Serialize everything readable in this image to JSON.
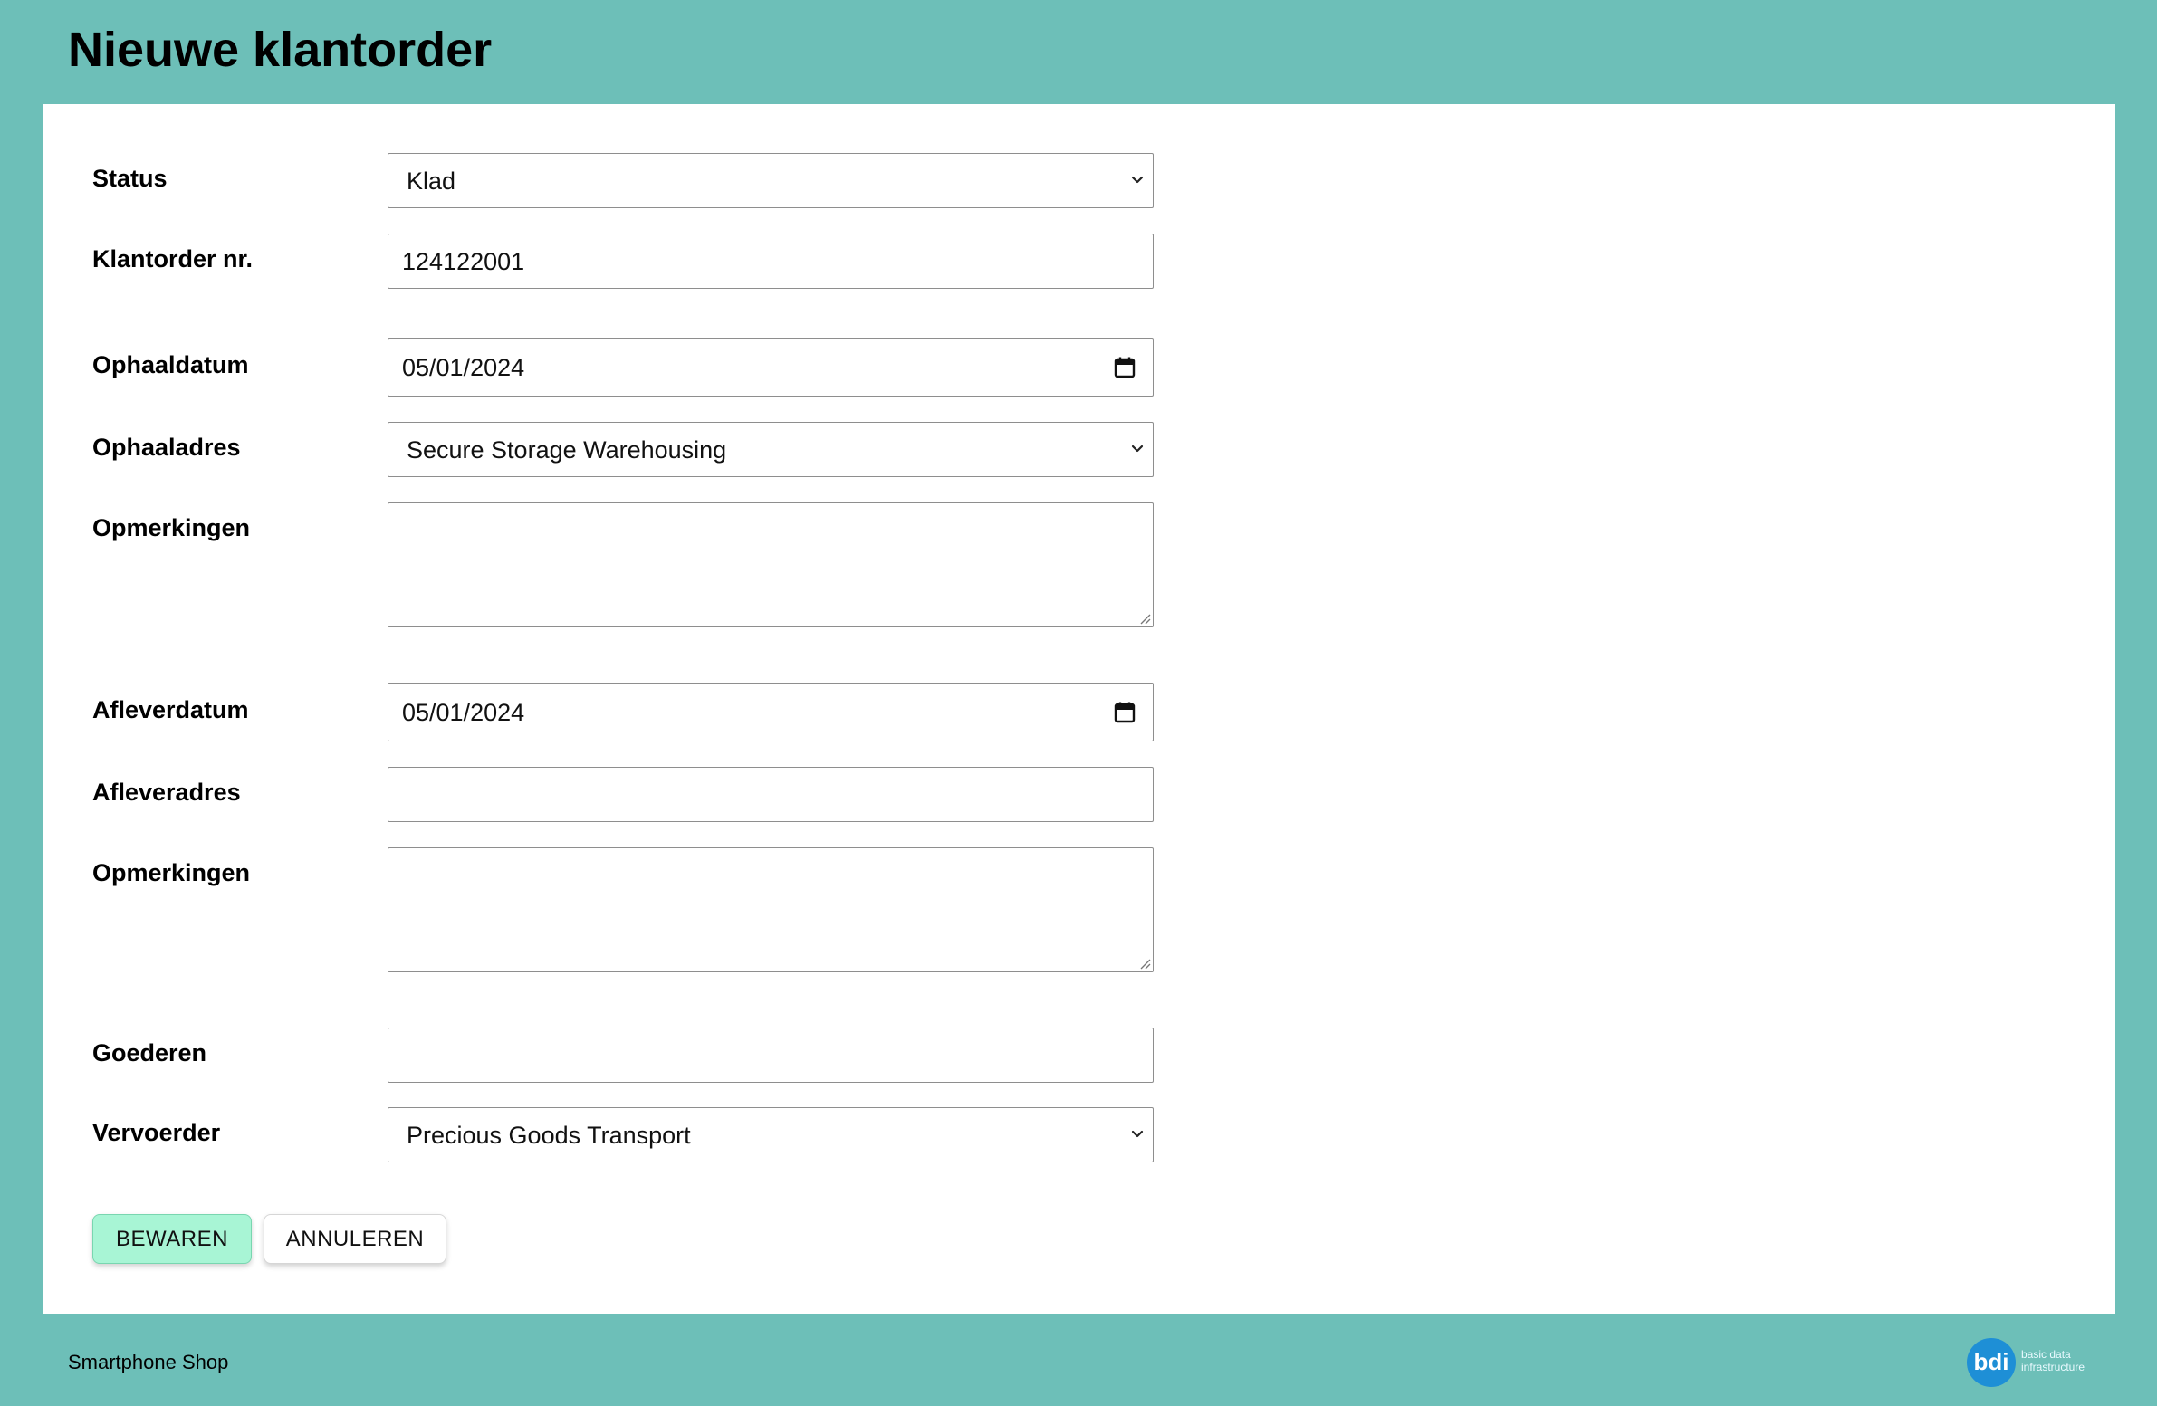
{
  "header": {
    "title": "Nieuwe klantorder"
  },
  "form": {
    "status": {
      "label": "Status",
      "value": "Klad"
    },
    "order_number": {
      "label": "Klantorder nr.",
      "value": "124122001"
    },
    "pickup_date": {
      "label": "Ophaaldatum",
      "value": "05/01/2024"
    },
    "pickup_address": {
      "label": "Ophaaladres",
      "value": "Secure Storage Warehousing"
    },
    "pickup_remarks": {
      "label": "Opmerkingen",
      "value": ""
    },
    "delivery_date": {
      "label": "Afleverdatum",
      "value": "05/01/2024"
    },
    "delivery_address": {
      "label": "Afleveradres",
      "value": ""
    },
    "delivery_remarks": {
      "label": "Opmerkingen",
      "value": ""
    },
    "goods": {
      "label": "Goederen",
      "value": ""
    },
    "carrier": {
      "label": "Vervoerder",
      "value": "Precious Goods Transport"
    }
  },
  "actions": {
    "save_label": "BEWAREN",
    "cancel_label": "ANNULEREN"
  },
  "footer": {
    "shop_name": "Smartphone Shop",
    "logo_mark": "bdi",
    "logo_text": "basic data infrastructure"
  },
  "colors": {
    "background": "#6dbfb8",
    "card": "#ffffff",
    "save_button": "#a8f5d5",
    "logo_blue": "#1e8fd6"
  },
  "icons": {
    "select_arrow": "chevron-down-icon",
    "date_picker": "calendar-icon",
    "textarea_resize": "resize-grip-icon"
  }
}
